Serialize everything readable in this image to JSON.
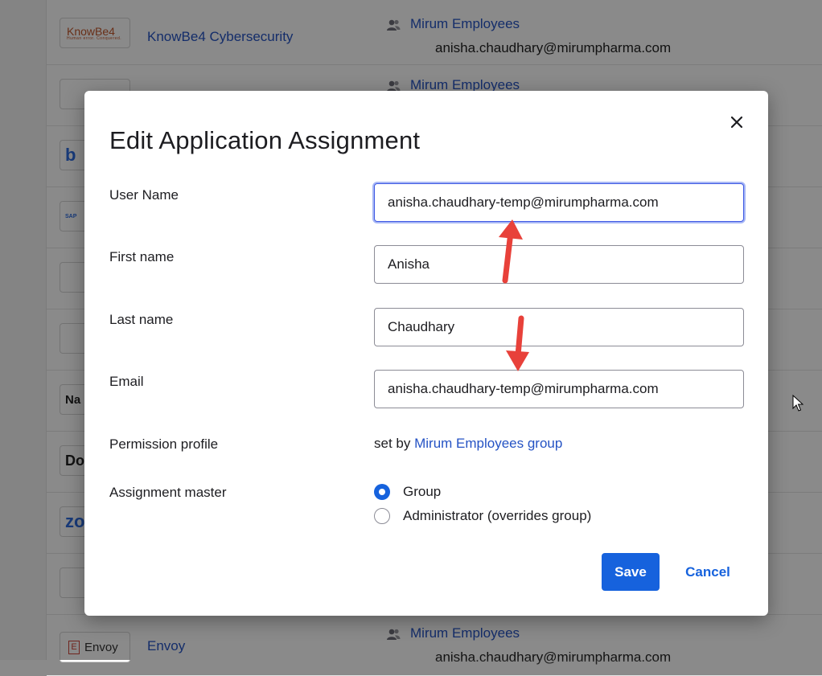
{
  "background": {
    "rows": [
      {
        "logo": "KnowBe4",
        "logo_sub": "Human error. Conquered.",
        "name": "KnowBe4 Cybersecurity",
        "group": "Mirum Employees",
        "email": "anisha.chaudhary@mirumpharma.com"
      },
      {
        "logo": "",
        "name": "",
        "group": "Mirum Employees",
        "email": ""
      },
      {
        "logo": "b",
        "name": "",
        "group": "",
        "email": ""
      },
      {
        "logo": "SAP",
        "name": "",
        "group": "",
        "email": ""
      },
      {
        "logo": "",
        "name": "",
        "group": "",
        "email": ""
      },
      {
        "logo": "",
        "name": "",
        "group": "",
        "email": ""
      },
      {
        "logo": "Na",
        "name": "",
        "group": "",
        "email": ""
      },
      {
        "logo": "Doc",
        "name": "",
        "group": "",
        "email": ""
      },
      {
        "logo": "zo",
        "name": "",
        "group": "",
        "email": ""
      },
      {
        "logo": "",
        "name": "",
        "group": "",
        "email": ""
      },
      {
        "logo": "Envoy",
        "name": "Envoy",
        "group": "Mirum Employees",
        "email": "anisha.chaudhary@mirumpharma.com"
      }
    ]
  },
  "modal": {
    "title": "Edit Application Assignment",
    "fields": {
      "user_name": {
        "label": "User Name",
        "value": "anisha.chaudhary-temp@mirumpharma.com"
      },
      "first_name": {
        "label": "First name",
        "value": "Anisha"
      },
      "last_name": {
        "label": "Last name",
        "value": "Chaudhary"
      },
      "email": {
        "label": "Email",
        "value": "anisha.chaudhary-temp@mirumpharma.com"
      }
    },
    "permission_profile": {
      "label": "Permission profile",
      "prefix": "set by",
      "link": "Mirum Employees group"
    },
    "assignment_master": {
      "label": "Assignment master",
      "options": [
        {
          "label": "Group",
          "checked": true
        },
        {
          "label": "Administrator (overrides group)",
          "checked": false
        }
      ]
    },
    "save_label": "Save",
    "cancel_label": "Cancel"
  },
  "colors": {
    "primary": "#1662dd",
    "link": "#2553c4",
    "annotation_arrow": "#e8413a"
  },
  "icons": {
    "close": "close-icon",
    "group": "group-icon",
    "cursor": "mouse-cursor-icon",
    "arrow": "annotation-arrow"
  }
}
